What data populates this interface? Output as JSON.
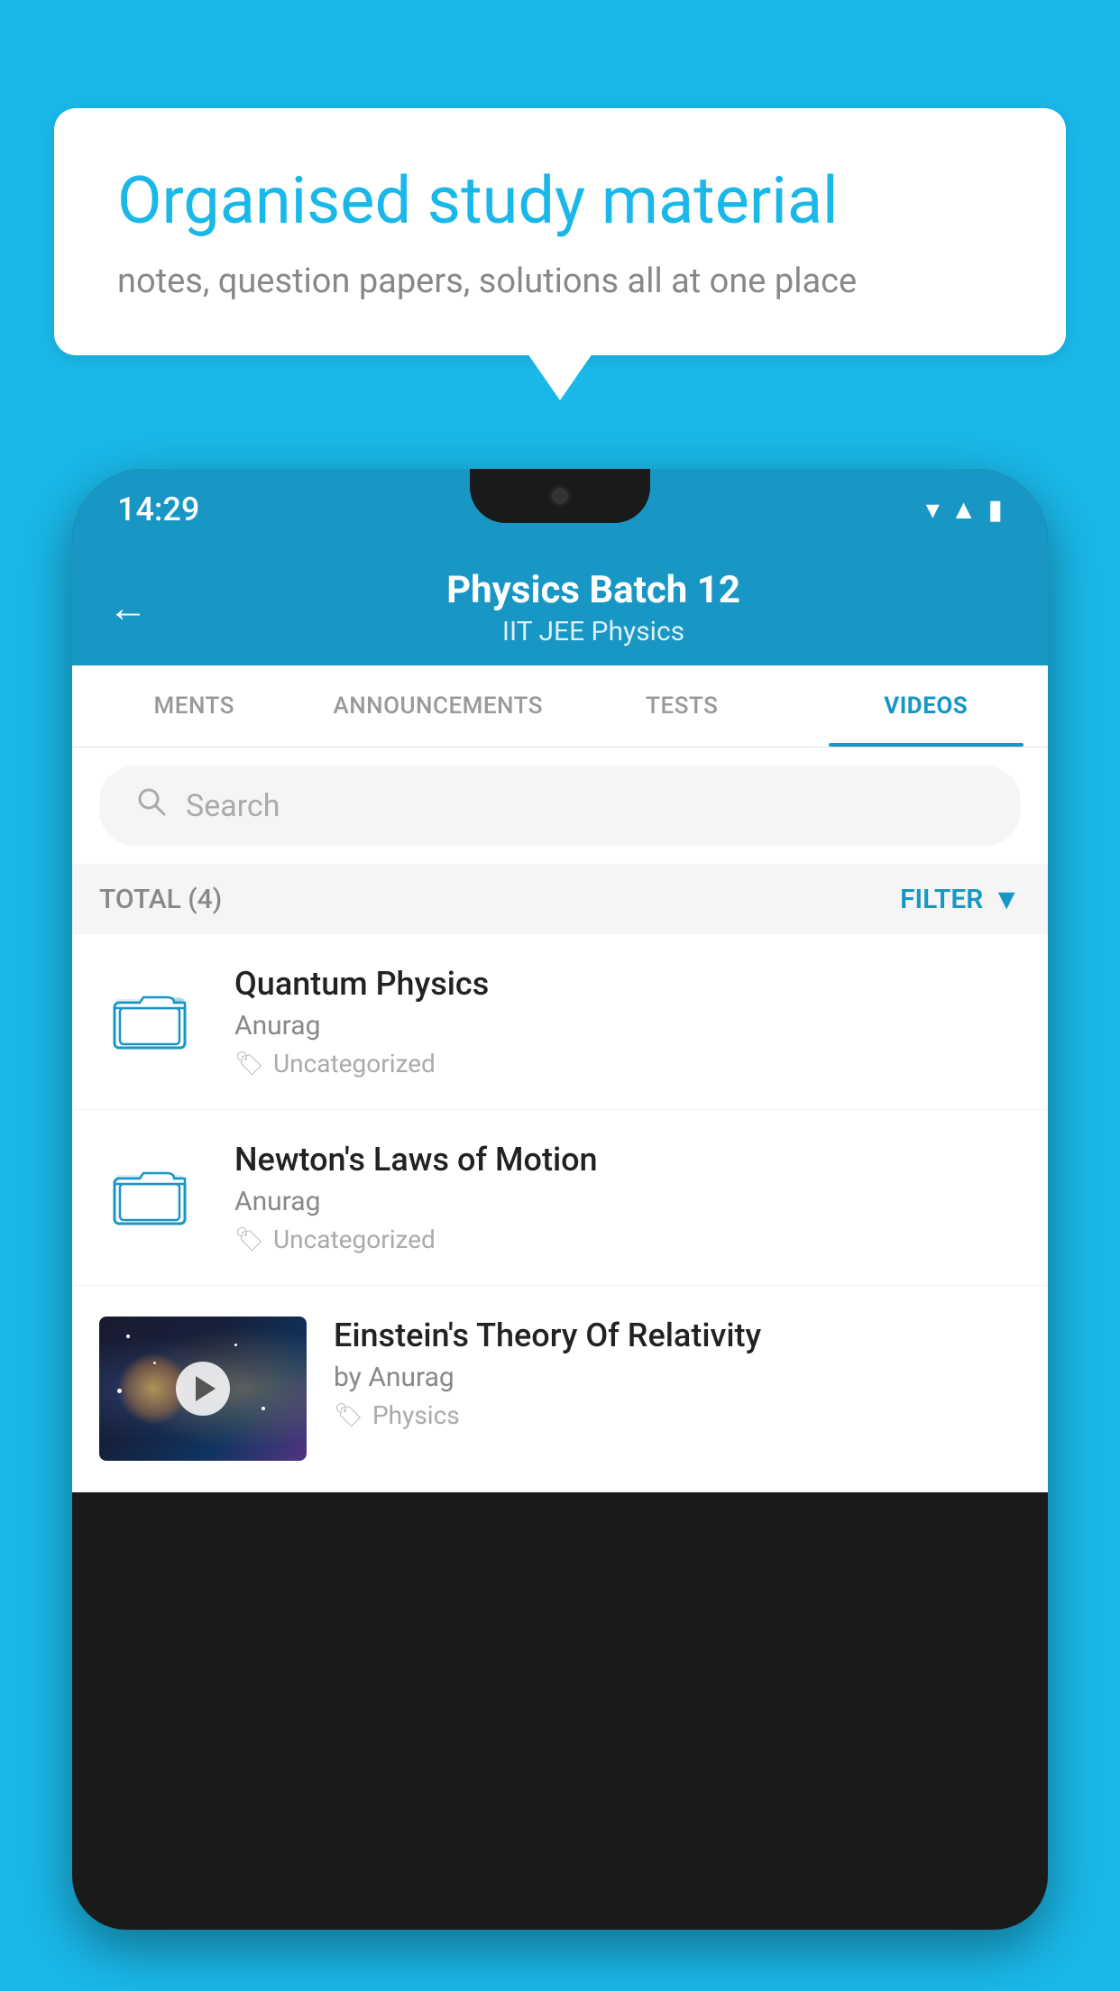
{
  "background_color": "#1ab8e8",
  "speech_bubble": {
    "title": "Organised study material",
    "subtitle": "notes, question papers, solutions all at one place"
  },
  "phone": {
    "status_bar": {
      "time": "14:29"
    },
    "header": {
      "back_label": "←",
      "title": "Physics Batch 12",
      "subtitle": "IIT JEE   Physics"
    },
    "tabs": [
      {
        "label": "MENTS",
        "active": false
      },
      {
        "label": "ANNOUNCEMENTS",
        "active": false
      },
      {
        "label": "TESTS",
        "active": false
      },
      {
        "label": "VIDEOS",
        "active": true
      }
    ],
    "search": {
      "placeholder": "Search"
    },
    "filter_bar": {
      "total_label": "TOTAL (4)",
      "filter_label": "FILTER"
    },
    "videos": [
      {
        "id": 1,
        "title": "Quantum Physics",
        "author": "Anurag",
        "tag": "Uncategorized",
        "has_thumbnail": false
      },
      {
        "id": 2,
        "title": "Newton's Laws of Motion",
        "author": "Anurag",
        "tag": "Uncategorized",
        "has_thumbnail": false
      },
      {
        "id": 3,
        "title": "Einstein's Theory Of Relativity",
        "author": "by Anurag",
        "tag": "Physics",
        "has_thumbnail": true
      }
    ]
  }
}
